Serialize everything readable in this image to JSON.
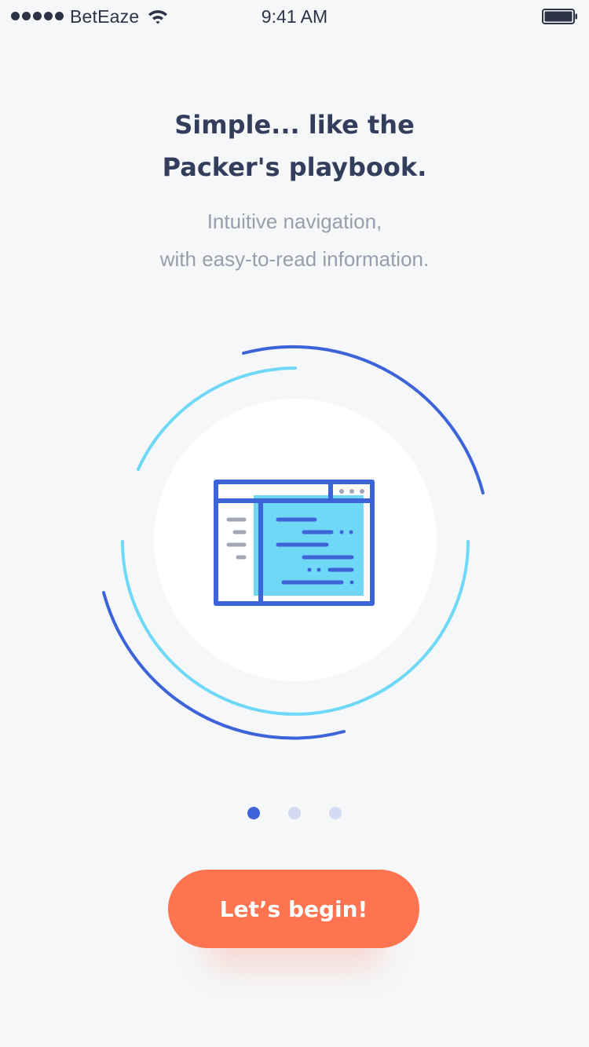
{
  "status_bar": {
    "carrier": "BetEaze",
    "time": "9:41 AM",
    "signal_icon": "signal-dots-icon",
    "wifi_icon": "wifi-icon",
    "battery_icon": "battery-icon"
  },
  "onboarding": {
    "headline_line1": "Simple... like the",
    "headline_line2": "Packer's playbook.",
    "subtitle_line1": "Intuitive navigation,",
    "subtitle_line2": "with easy-to-read information.",
    "illustration_icon": "browser-window-icon",
    "pager": {
      "total_pages": 3,
      "current_page": 1
    },
    "cta_label": "Let’s begin!"
  },
  "colors": {
    "background": "#f5f7f9",
    "heading": "#333d5c",
    "subtitle": "#9a9dab",
    "accent_blue": "#3c63d8",
    "light_blue": "#6fd8f6",
    "cta": "#ff7450",
    "dot_inactive": "#d3dbf1"
  }
}
